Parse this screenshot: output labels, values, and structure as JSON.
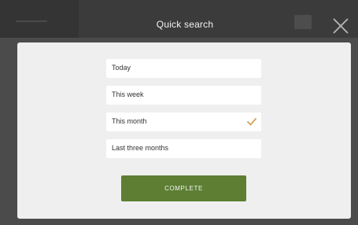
{
  "dialog": {
    "title": "Quick search",
    "options": [
      {
        "label": "Today",
        "selected": false
      },
      {
        "label": "This week",
        "selected": false
      },
      {
        "label": "This month",
        "selected": true
      },
      {
        "label": "Last three months",
        "selected": false
      }
    ],
    "complete_label": "COMPLETE"
  },
  "colors": {
    "accent": "#5d7e33",
    "check": "#d7a15d"
  },
  "icons": {
    "close": "close-icon",
    "selected": "checkmark-icon"
  }
}
